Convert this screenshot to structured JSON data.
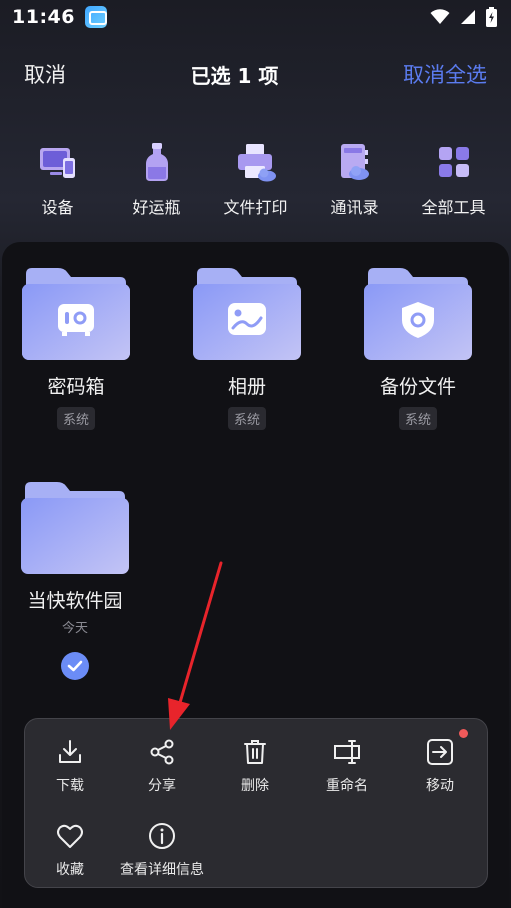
{
  "status": {
    "time": "11:46"
  },
  "header": {
    "cancel": "取消",
    "title": "已选 1 项",
    "unselect_all": "取消全选"
  },
  "tools": [
    {
      "label": "设备",
      "icon": "device-icon"
    },
    {
      "label": "好运瓶",
      "icon": "bottle-icon"
    },
    {
      "label": "文件打印",
      "icon": "printer-icon"
    },
    {
      "label": "通讯录",
      "icon": "contacts-icon"
    },
    {
      "label": "全部工具",
      "icon": "grid-icon"
    }
  ],
  "folders": [
    {
      "name": "密码箱",
      "badge": "系统",
      "icon": "safe-icon"
    },
    {
      "name": "相册",
      "badge": "系统",
      "icon": "photo-icon"
    },
    {
      "name": "备份文件",
      "badge": "系统",
      "icon": "shield-icon"
    },
    {
      "name": "当快软件园",
      "sub": "今天",
      "selected": true
    }
  ],
  "actions": [
    {
      "label": "下载",
      "icon": "download-icon"
    },
    {
      "label": "分享",
      "icon": "share-icon"
    },
    {
      "label": "删除",
      "icon": "trash-icon"
    },
    {
      "label": "重命名",
      "icon": "rename-icon"
    },
    {
      "label": "移动",
      "icon": "move-icon",
      "has_dot": true
    },
    {
      "label": "收藏",
      "icon": "heart-icon"
    },
    {
      "label": "查看详细信息",
      "icon": "info-icon"
    }
  ],
  "colors": {
    "accent": "#5b7cf0",
    "folder": "#8f9cf6",
    "sheet": "#2b2b30",
    "arrow": "#e8242b"
  }
}
